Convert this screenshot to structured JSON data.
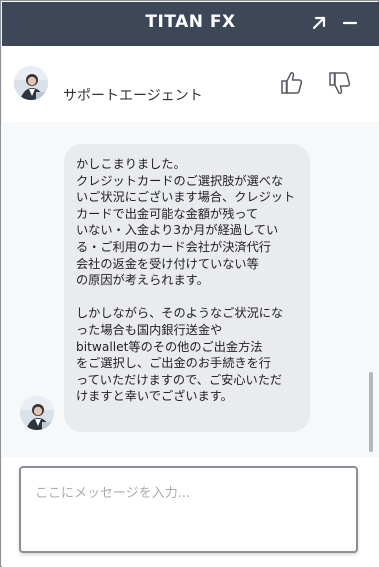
{
  "window": {
    "title": "TITAN FX",
    "popout_icon": "arrow-up-right-icon",
    "minimize_icon": "minimize-icon",
    "titlebar_color": "#3e4757"
  },
  "header": {
    "agent_name": "サポートエージェント",
    "avatar_icon": "agent-avatar",
    "thumbs_up_icon": "thumbs-up-icon",
    "thumbs_down_icon": "thumbs-down-icon"
  },
  "messages": [
    {
      "sender": "agent",
      "paragraphs": [
        [
          "かしこまりました。",
          "クレジットカードのご選択肢が選べな",
          "いご状況にございます場合、クレジット",
          "カードで出金可能な金額が残って",
          "いない・入金より3か月が経過してい",
          "る・ご利用のカード会社が決済代行",
          "会社の返金を受け付けていない等",
          "の原因が考えられます。"
        ],
        [
          "しかしながら、そのようなご状況にな",
          "った場合も国内銀行送金や",
          "bitwallet等のその他のご出金方法",
          "をご選択し、ご出金のお手続きを行",
          "っていただけますので、ご安心いただ",
          "けますと幸いでございます。"
        ]
      ]
    }
  ],
  "composer": {
    "placeholder": "ここにメッセージを入力...",
    "value": ""
  }
}
